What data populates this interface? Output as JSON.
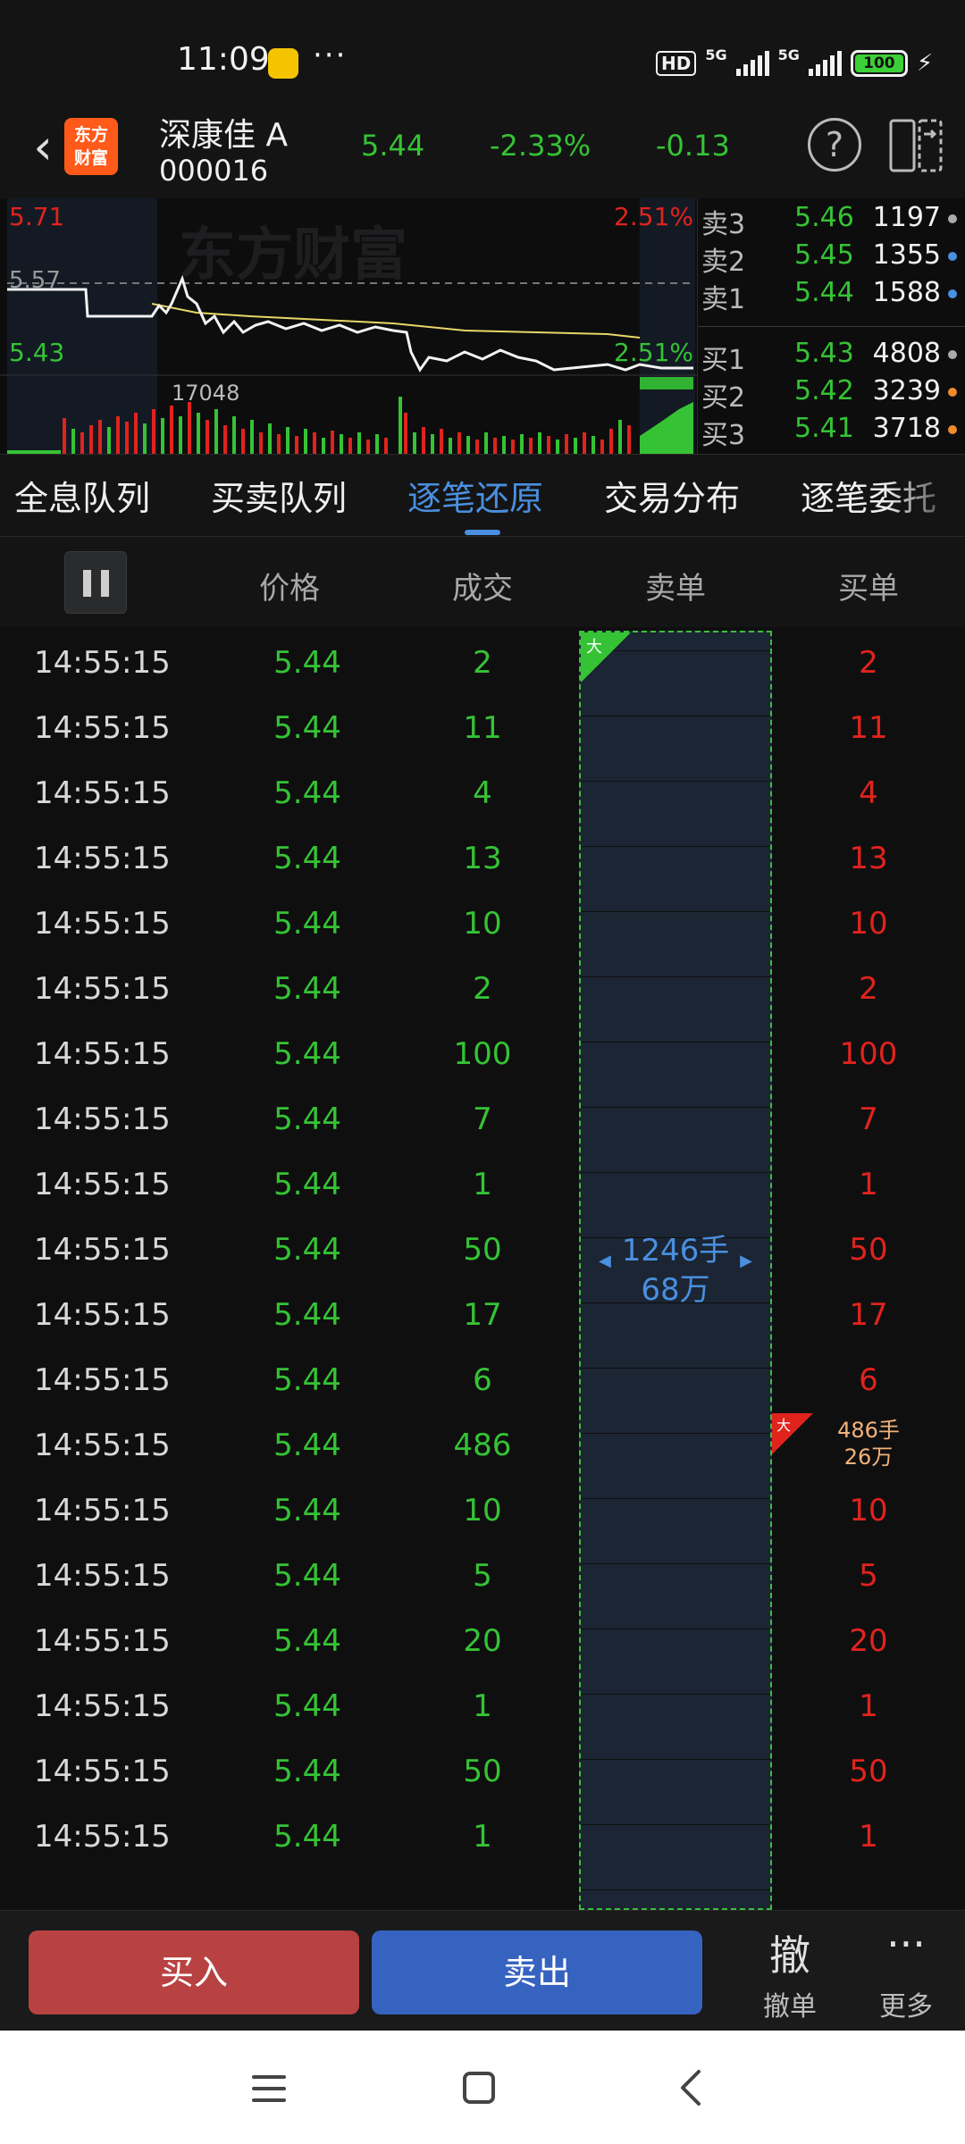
{
  "status_bar": {
    "time": "11:09",
    "dots": "···",
    "hd": "HD",
    "net1": "5G",
    "net2": "5G",
    "battery": "100"
  },
  "header": {
    "logo_line1": "东方",
    "logo_line2": "财富",
    "stock_name": "深康佳 A",
    "stock_code": "000016",
    "price": "5.44",
    "change_pct": "-2.33%",
    "change": "-0.13",
    "colors": {
      "down": "#35c335",
      "up": "#e0231d",
      "accent": "#4a8fe0"
    }
  },
  "chart": {
    "high_label": "5.71",
    "ref_label": "5.57",
    "low_label": "5.43",
    "up_pct": "2.51%",
    "down_pct": "2.51%",
    "volume_peak": "17048",
    "watermark": "东方财富"
  },
  "order_book": {
    "asks": [
      {
        "label": "卖3",
        "price": "5.46",
        "volume": "1197",
        "dot": "#aaaaaa"
      },
      {
        "label": "卖2",
        "price": "5.45",
        "volume": "1355",
        "dot": "#4a8fe0"
      },
      {
        "label": "卖1",
        "price": "5.44",
        "volume": "1588",
        "dot": "#4a8fe0"
      }
    ],
    "bids": [
      {
        "label": "买1",
        "price": "5.43",
        "volume": "4808",
        "dot": "#aaaaaa"
      },
      {
        "label": "买2",
        "price": "5.42",
        "volume": "3239",
        "dot": "#f08a2c"
      },
      {
        "label": "买3",
        "price": "5.41",
        "volume": "3718",
        "dot": "#f08a2c"
      }
    ]
  },
  "tabs": [
    "全息队列",
    "买卖队列",
    "逐笔还原",
    "交易分布",
    "逐笔委托"
  ],
  "active_tab": "逐笔还原",
  "columns": {
    "price": "价格",
    "volume": "成交",
    "sell": "卖单",
    "buy": "买单"
  },
  "rows": [
    {
      "time": "14:55:15",
      "price": "5.44",
      "volume": "2",
      "buy": "2"
    },
    {
      "time": "14:55:15",
      "price": "5.44",
      "volume": "11",
      "buy": "11"
    },
    {
      "time": "14:55:15",
      "price": "5.44",
      "volume": "4",
      "buy": "4"
    },
    {
      "time": "14:55:15",
      "price": "5.44",
      "volume": "13",
      "buy": "13"
    },
    {
      "time": "14:55:15",
      "price": "5.44",
      "volume": "10",
      "buy": "10"
    },
    {
      "time": "14:55:15",
      "price": "5.44",
      "volume": "2",
      "buy": "2"
    },
    {
      "time": "14:55:15",
      "price": "5.44",
      "volume": "100",
      "buy": "100"
    },
    {
      "time": "14:55:15",
      "price": "5.44",
      "volume": "7",
      "buy": "7"
    },
    {
      "time": "14:55:15",
      "price": "5.44",
      "volume": "1",
      "buy": "1"
    },
    {
      "time": "14:55:15",
      "price": "5.44",
      "volume": "50",
      "buy": "50"
    },
    {
      "time": "14:55:15",
      "price": "5.44",
      "volume": "17",
      "buy": "17"
    },
    {
      "time": "14:55:15",
      "price": "5.44",
      "volume": "6",
      "buy": "6"
    },
    {
      "time": "14:55:15",
      "price": "5.44",
      "volume": "486",
      "buy": "486手\n26万"
    },
    {
      "time": "14:55:15",
      "price": "5.44",
      "volume": "10",
      "buy": "10"
    },
    {
      "time": "14:55:15",
      "price": "5.44",
      "volume": "5",
      "buy": "5"
    },
    {
      "time": "14:55:15",
      "price": "5.44",
      "volume": "20",
      "buy": "20"
    },
    {
      "time": "14:55:15",
      "price": "5.44",
      "volume": "1",
      "buy": "1"
    },
    {
      "time": "14:55:15",
      "price": "5.44",
      "volume": "50",
      "buy": "50"
    },
    {
      "time": "14:55:15",
      "price": "5.44",
      "volume": "1",
      "buy": "1"
    }
  ],
  "sell_aggregate": {
    "line1": "1246手",
    "line2": "68万",
    "flag": "大"
  },
  "buy_aggregate": {
    "line1": "486手",
    "line2": "26万",
    "flag": "大"
  },
  "bottom_bar": {
    "buy": "买入",
    "sell": "卖出",
    "cancel_icon": "撤",
    "cancel": "撤单",
    "more_icon": "···",
    "more": "更多"
  }
}
